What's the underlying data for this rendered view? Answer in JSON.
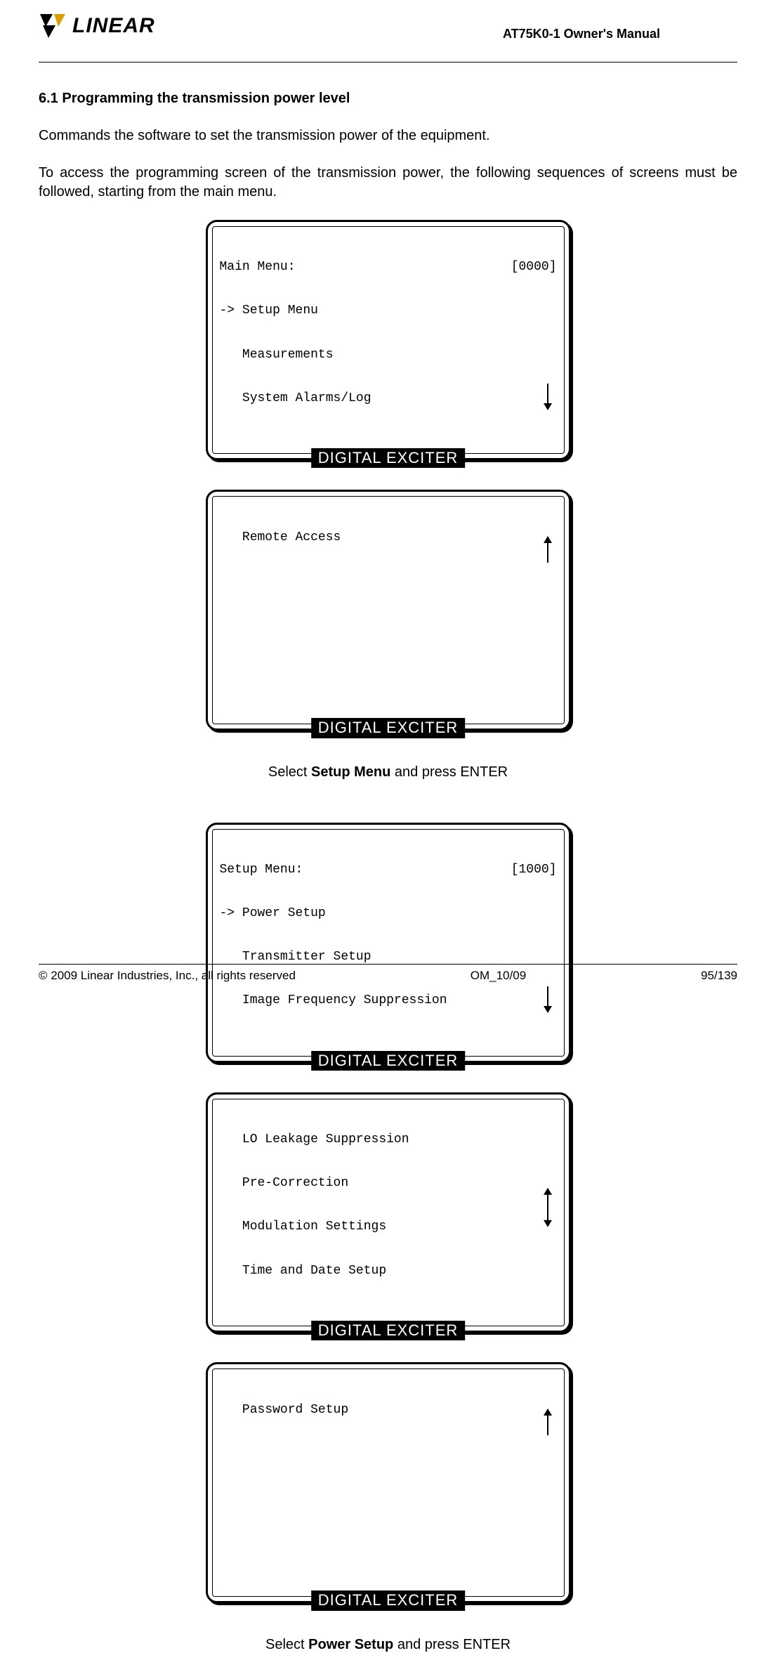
{
  "header": {
    "brand": "LINEAR",
    "doc_title": "AT75K0-1 Owner's Manual"
  },
  "section": {
    "heading": "6.1 Programming the transmission power level",
    "para1": "Commands the software to set the transmission power of the equipment.",
    "para2": "To access the programming screen of the transmission power, the following sequences of screens must be followed, starting from the main menu."
  },
  "panels": {
    "label": "DIGITAL EXCITER",
    "main1": {
      "title": "Main Menu:",
      "code": "[0000]",
      "selected": "Setup Menu",
      "items": [
        "Measurements",
        "System Alarms/Log"
      ]
    },
    "main2": {
      "items": [
        "Remote Access"
      ]
    },
    "caption1_pre": "Select ",
    "caption1_bold": "Setup Menu",
    "caption1_post": " and press ENTER",
    "setup1": {
      "title": "Setup Menu:",
      "code": "[1000]",
      "selected": "Power Setup",
      "items": [
        "Transmitter Setup",
        "Image Frequency Suppression"
      ]
    },
    "setup2": {
      "items": [
        "LO Leakage Suppression",
        "Pre-Correction",
        "Modulation Settings",
        "Time and Date Setup"
      ]
    },
    "setup3": {
      "items": [
        "Password Setup"
      ]
    },
    "caption2_pre": "Select ",
    "caption2_bold": "Power Setup",
    "caption2_post": " and press ENTER"
  },
  "footer": {
    "left": "© 2009 Linear Industries, Inc., all rights reserved",
    "center": "OM_10/09",
    "right": "95/139"
  }
}
